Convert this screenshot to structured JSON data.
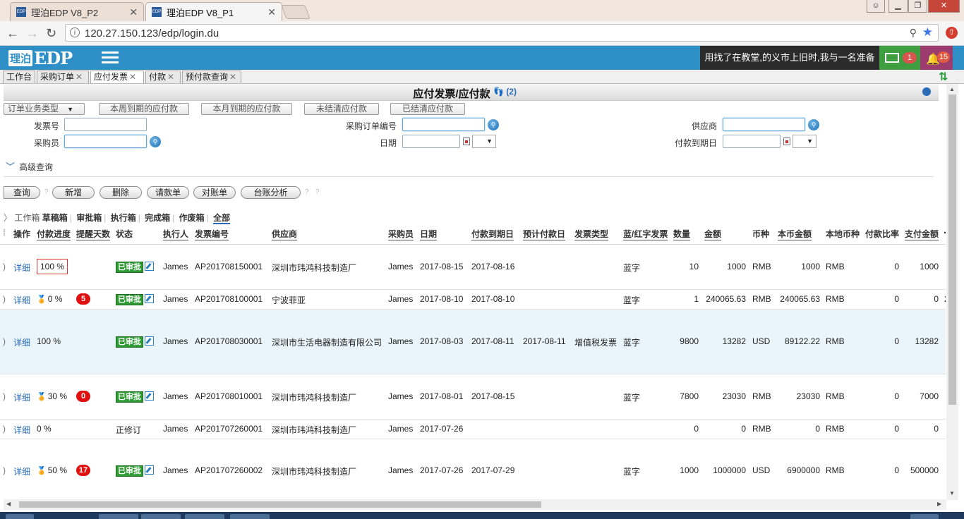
{
  "browser": {
    "tabs": [
      {
        "title": "理泊EDP V8_P2",
        "favicon": "EDP",
        "active": false
      },
      {
        "title": "理泊EDP V8_P1",
        "favicon": "EDP",
        "active": true
      }
    ],
    "url": "120.27.150.123/edp/login.du"
  },
  "header": {
    "logo_badge": "理泊",
    "logo_text": "EDP",
    "ticker": "用找了在教堂,的义市上旧时,我与一名准备",
    "mail_count": "1",
    "notify_count": "15",
    "colors": {
      "bar": "#2d8fc6",
      "mail": "#3f9e3f",
      "notify": "#9b3b6e"
    }
  },
  "page_tabs": [
    {
      "label": "工作台",
      "closable": false,
      "active": false
    },
    {
      "label": "采购订单",
      "closable": true,
      "active": false
    },
    {
      "label": "应付发票",
      "closable": true,
      "active": true
    },
    {
      "label": "付款",
      "closable": true,
      "active": false
    },
    {
      "label": "预付款查询",
      "closable": true,
      "active": false
    }
  ],
  "title": {
    "text": "应付发票/应付款",
    "help": "?",
    "users": "(2)"
  },
  "quick_filters": {
    "dropdown": "订单业务类型",
    "buttons": [
      "本周到期的应付款",
      "本月到期的应付款",
      "未结清应付款",
      "已结清应付款"
    ]
  },
  "search": {
    "invoice_no_label": "发票号",
    "buyer_label": "采购员",
    "po_no_label": "采购订单编号",
    "date_label": "日期",
    "supplier_label": "供应商",
    "due_date_label": "付款到期日",
    "advanced_label": "高级查询"
  },
  "actions": {
    "query": "查询",
    "buttons": [
      "新增",
      "删除",
      "请款单",
      "对账单",
      "台账分析"
    ],
    "help": "?"
  },
  "box_tabs": [
    "工作箱",
    "草稿箱",
    "审批箱",
    "执行箱",
    "完成箱",
    "作废箱",
    "全部"
  ],
  "columns": [
    "操作",
    "付款进度",
    "提醒天数",
    "状态",
    "执行人",
    "发票编号",
    "供应商",
    "采购员",
    "日期",
    "付款到期日",
    "预计付款日",
    "发票类型",
    "蓝/红字发票",
    "数量",
    "金额",
    "币种",
    "本币金额",
    "本地币种",
    "付款比率",
    "支付金额"
  ],
  "rows": [
    {
      "op": "详细",
      "progress": "100 %",
      "medal": false,
      "boxed": true,
      "remind": "",
      "status": "已审批",
      "status_badge": true,
      "executor": "James",
      "invoice_no": "AP201708150001",
      "supplier": "深圳市玮鸿科技制造厂",
      "buyer": "James",
      "date": "2017-08-15",
      "due": "2017-08-16",
      "est": "",
      "type": "",
      "color": "蓝字",
      "qty": "10",
      "amount": "1000",
      "currency": "RMB",
      "local_amount": "1000",
      "local_currency": "RMB",
      "ratio": "0",
      "paid": "1000",
      "extra": ""
    },
    {
      "op": "详细",
      "progress": "0 %",
      "medal": true,
      "boxed": false,
      "remind": "5",
      "status": "已审批",
      "status_badge": true,
      "executor": "James",
      "invoice_no": "AP201708100001",
      "supplier": "宁波菲亚",
      "buyer": "James",
      "date": "2017-08-10",
      "due": "2017-08-10",
      "est": "",
      "type": "",
      "color": "蓝字",
      "qty": "1",
      "amount": "240065.63",
      "currency": "RMB",
      "local_amount": "240065.63",
      "local_currency": "RMB",
      "ratio": "0",
      "paid": "0",
      "extra": "2"
    },
    {
      "op": "详细",
      "progress": "100 %",
      "medal": false,
      "boxed": false,
      "remind": "",
      "status": "已审批",
      "status_badge": true,
      "executor": "James",
      "invoice_no": "AP201708030001",
      "supplier": "深圳市生活电器制造有限公司",
      "buyer": "James",
      "date": "2017-08-03",
      "due": "2017-08-11",
      "est": "2017-08-11",
      "type": "增值税发票",
      "color": "蓝字",
      "qty": "9800",
      "amount": "13282",
      "currency": "USD",
      "local_amount": "89122.22",
      "local_currency": "RMB",
      "ratio": "0",
      "paid": "13282",
      "extra": ""
    },
    {
      "op": "详细",
      "progress": "30 %",
      "medal": true,
      "boxed": false,
      "remind": "0",
      "status": "已审批",
      "status_badge": true,
      "executor": "James",
      "invoice_no": "AP201708010001",
      "supplier": "深圳市玮鸿科技制造厂",
      "buyer": "James",
      "date": "2017-08-01",
      "due": "2017-08-15",
      "est": "",
      "type": "",
      "color": "蓝字",
      "qty": "7800",
      "amount": "23030",
      "currency": "RMB",
      "local_amount": "23030",
      "local_currency": "RMB",
      "ratio": "0",
      "paid": "7000",
      "extra": ""
    },
    {
      "op": "详细",
      "progress": "0 %",
      "medal": false,
      "boxed": false,
      "remind": "",
      "status": "正修订",
      "status_badge": false,
      "executor": "James",
      "invoice_no": "AP201707260001",
      "supplier": "深圳市玮鸿科技制造厂",
      "buyer": "James",
      "date": "2017-07-26",
      "due": "",
      "est": "",
      "type": "",
      "color": "",
      "qty": "0",
      "amount": "0",
      "currency": "RMB",
      "local_amount": "0",
      "local_currency": "RMB",
      "ratio": "0",
      "paid": "0",
      "extra": ""
    },
    {
      "op": "详细",
      "progress": "50 %",
      "medal": true,
      "boxed": false,
      "remind": "17",
      "status": "已审批",
      "status_badge": true,
      "executor": "James",
      "invoice_no": "AP201707260002",
      "supplier": "深圳市玮鸿科技制造厂",
      "buyer": "James",
      "date": "2017-07-26",
      "due": "2017-07-29",
      "est": "",
      "type": "",
      "color": "蓝字",
      "qty": "1000",
      "amount": "1000000",
      "currency": "USD",
      "local_amount": "6900000",
      "local_currency": "RMB",
      "ratio": "0",
      "paid": "500000",
      "extra": ""
    }
  ]
}
